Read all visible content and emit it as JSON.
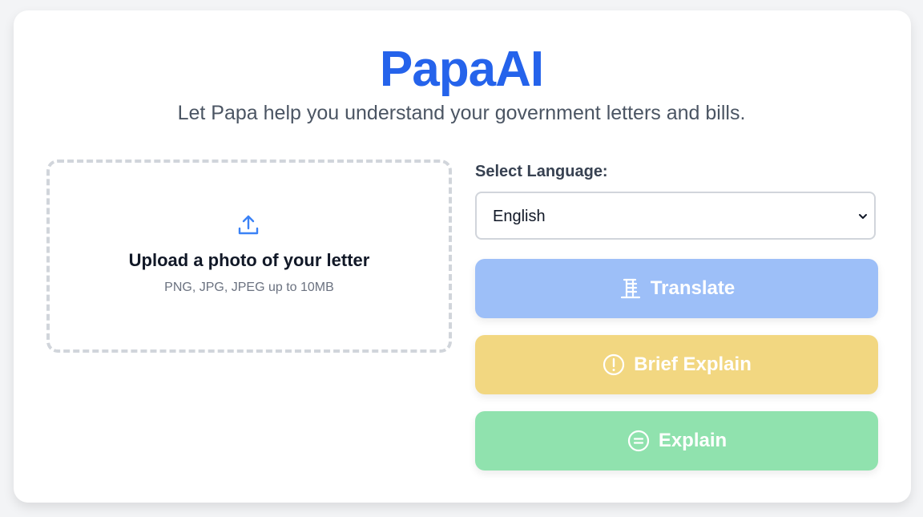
{
  "app": {
    "title": "PapaAI",
    "subtitle": "Let Papa help you understand your government letters and bills."
  },
  "upload": {
    "icon": "upload-icon",
    "title": "Upload a photo of your letter",
    "hint": "PNG, JPG, JPEG up to 10MB"
  },
  "language": {
    "label": "Select Language:",
    "selected": "English"
  },
  "actions": {
    "translate": {
      "label": "Translate",
      "icon": "translate-icon",
      "color": "#9dbff8"
    },
    "brief": {
      "label": "Brief Explain",
      "icon": "alert-circle-icon",
      "color": "#f2d781"
    },
    "explain": {
      "label": "Explain",
      "icon": "equals-circle-icon",
      "color": "#90e2ae"
    }
  },
  "colors": {
    "brand": "#2563eb",
    "background": "#f3f4f6"
  }
}
